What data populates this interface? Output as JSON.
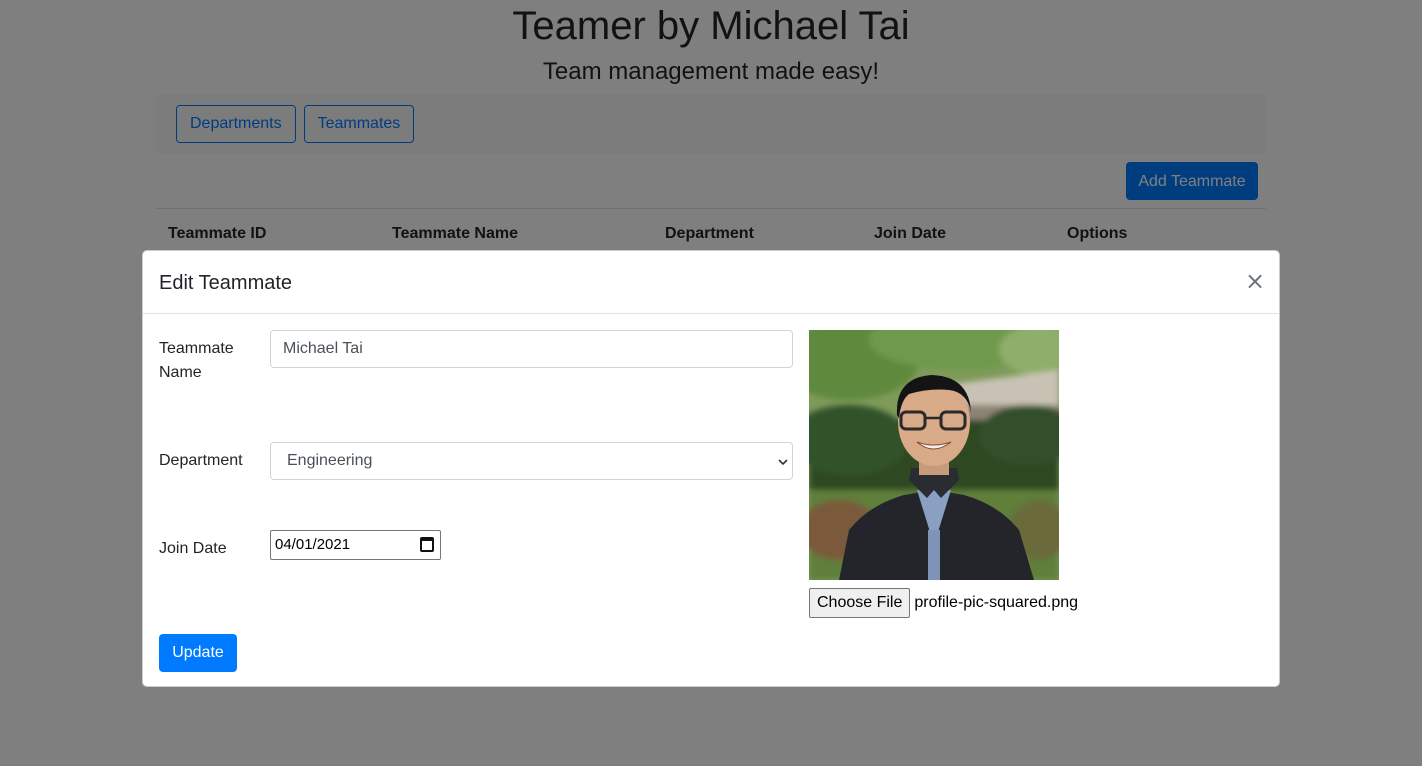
{
  "app": {
    "title": "Teamer by Michael Tai",
    "subtitle": "Team management made easy!"
  },
  "nav": {
    "items": [
      {
        "label": "Departments"
      },
      {
        "label": "Teammates"
      }
    ]
  },
  "toolbar": {
    "add_label": "Add Teammate"
  },
  "table": {
    "columns": [
      "Teammate ID",
      "Teammate Name",
      "Department",
      "Join Date",
      "Options"
    ]
  },
  "modal": {
    "title": "Edit Teammate",
    "close_icon": "×",
    "fields": {
      "name": {
        "label": "Teammate Name",
        "value": "Michael Tai"
      },
      "department": {
        "label": "Department",
        "selected": "Engineering",
        "chevron": "⌄"
      },
      "join_date": {
        "label": "Join Date",
        "value": "04/01/2021"
      }
    },
    "photo": {
      "alt": "Profile photo of smiling man with glasses in front of hedge"
    },
    "file_input": {
      "button_label": "Choose File",
      "file_name": "profile-pic-squared.png"
    },
    "submit_label": "Update"
  },
  "colors": {
    "primary": "#007bff",
    "backdrop": "rgba(0,0,0,0.5)"
  }
}
